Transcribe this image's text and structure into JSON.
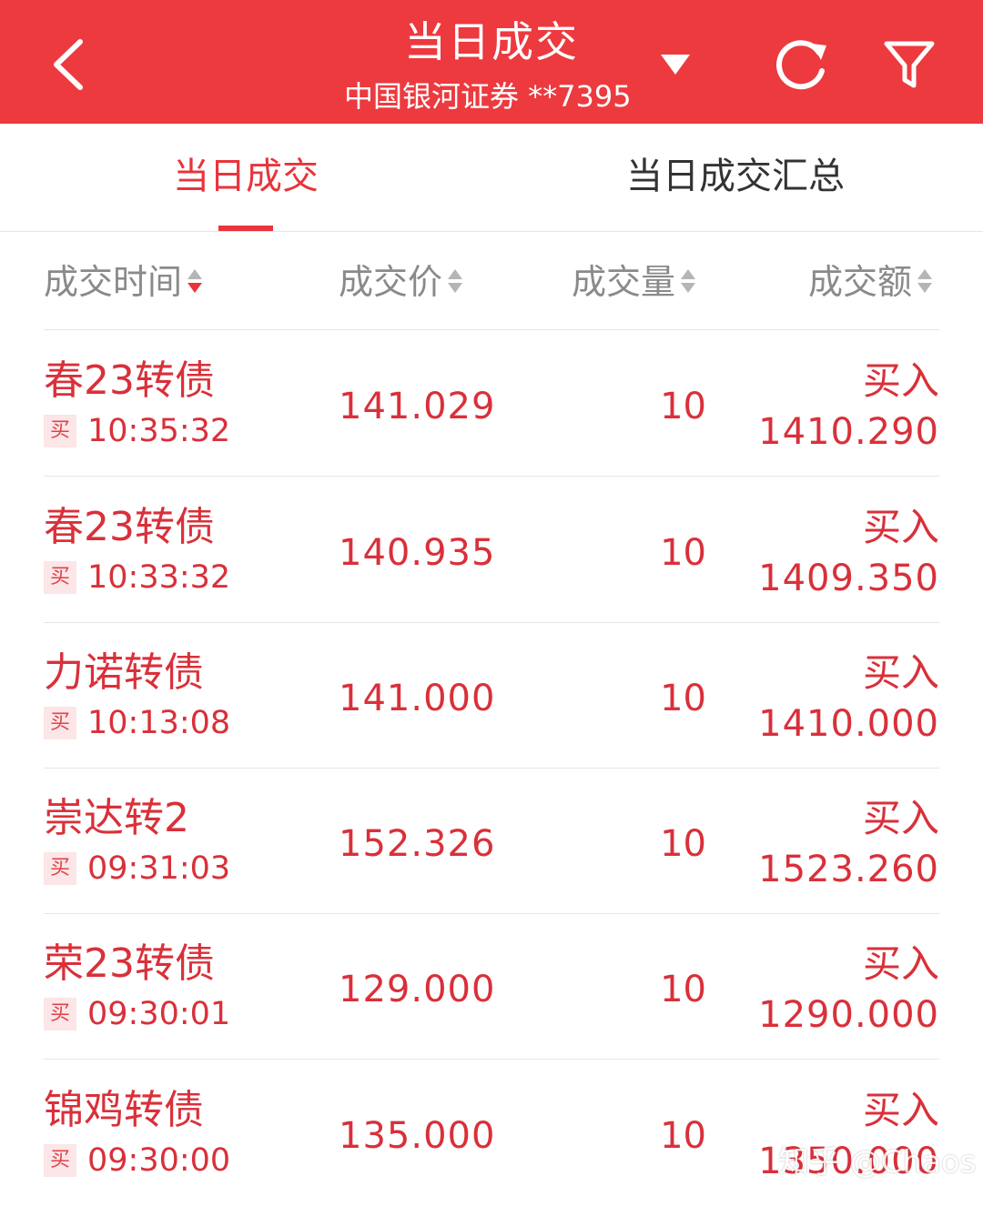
{
  "header": {
    "title": "当日成交",
    "account": "中国银河证券 **7395",
    "icons": [
      "back-arrow-icon",
      "dropdown-triangle-icon",
      "refresh-icon",
      "filter-icon"
    ]
  },
  "tabs": [
    {
      "label": "当日成交",
      "active": true
    },
    {
      "label": "当日成交汇总",
      "active": false
    }
  ],
  "columns": {
    "time": "成交时间",
    "price": "成交价",
    "quantity": "成交量",
    "amount": "成交额"
  },
  "rows": [
    {
      "name": "春23转债",
      "badge": "买",
      "time": "10:35:32",
      "price": "141.029",
      "qty": "10",
      "dir": "买入",
      "amount": "1410.290"
    },
    {
      "name": "春23转债",
      "badge": "买",
      "time": "10:33:32",
      "price": "140.935",
      "qty": "10",
      "dir": "买入",
      "amount": "1409.350"
    },
    {
      "name": "力诺转债",
      "badge": "买",
      "time": "10:13:08",
      "price": "141.000",
      "qty": "10",
      "dir": "买入",
      "amount": "1410.000"
    },
    {
      "name": "崇达转2",
      "badge": "买",
      "time": "09:31:03",
      "price": "152.326",
      "qty": "10",
      "dir": "买入",
      "amount": "1523.260"
    },
    {
      "name": "荣23转债",
      "badge": "买",
      "time": "09:30:01",
      "price": "129.000",
      "qty": "10",
      "dir": "买入",
      "amount": "1290.000"
    },
    {
      "name": "锦鸡转债",
      "badge": "买",
      "time": "09:30:00",
      "price": "135.000",
      "qty": "10",
      "dir": "买入",
      "amount": "1350.000"
    }
  ],
  "watermark": "知乎 @Chaos",
  "colors": {
    "brand": "#ec3a3f",
    "text_red": "#d9303a",
    "badge_bg": "#fce6e7"
  }
}
